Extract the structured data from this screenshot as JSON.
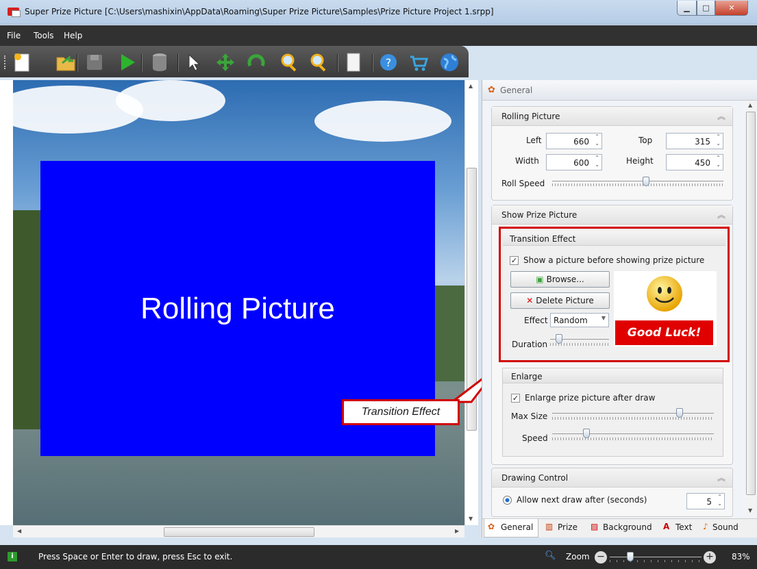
{
  "window": {
    "title": "Super Prize Picture [C:\\Users\\mashixin\\AppData\\Roaming\\Super Prize Picture\\Samples\\Prize Picture Project 1.srpp]",
    "min": "▁",
    "max": "□",
    "close": "✕"
  },
  "menu": [
    "File",
    "Tools",
    "Help"
  ],
  "toolbar": [
    {
      "icon": "new-document-icon"
    },
    {
      "icon": "open-folder-icon"
    },
    {
      "icon": "save-icon"
    },
    {
      "icon": "play-icon"
    },
    {
      "icon": "database-icon"
    },
    {
      "icon": "pointer-icon"
    },
    {
      "icon": "move-icon"
    },
    {
      "icon": "rotate-icon"
    },
    {
      "icon": "zoom-in-icon"
    },
    {
      "icon": "zoom-out-icon"
    },
    {
      "icon": "page-icon"
    },
    {
      "icon": "help-icon"
    },
    {
      "icon": "cart-icon"
    },
    {
      "icon": "globe-icon"
    }
  ],
  "canvas": {
    "rolling_text": "Rolling Picture",
    "callout": "Transition Effect"
  },
  "panel": {
    "header": "General",
    "rolling": {
      "title": "Rolling Picture",
      "left_label": "Left",
      "left": "660",
      "top_label": "Top",
      "top": "315",
      "width_label": "Width",
      "width": "600",
      "height_label": "Height",
      "height": "450",
      "speed_label": "Roll Speed",
      "speed_level": 0.55
    },
    "show_prize": {
      "title": "Show Prize Picture"
    },
    "transition": {
      "title": "Transition Effect",
      "checkbox_label": "Show a picture before showing prize picture",
      "checked": true,
      "browse": "Browse...",
      "delete": "Delete Picture",
      "effect_label": "Effect",
      "effect_value": "Random",
      "duration_label": "Duration",
      "duration_level": 0.1,
      "good_luck": "Good Luck!"
    },
    "enlarge": {
      "title": "Enlarge",
      "checkbox_label": "Enlarge prize picture after draw",
      "checked": true,
      "max_label": "Max Size",
      "max_level": 0.8,
      "speed_label": "Speed",
      "speed_level": 0.2
    },
    "drawing": {
      "title": "Drawing Control",
      "radio_label": "Allow next draw after (seconds)",
      "seconds": "5"
    },
    "tabs": [
      "General",
      "Prize",
      "Background",
      "Text",
      "Sound"
    ]
  },
  "status": {
    "message": "Press Space or Enter to draw, press Esc to exit.",
    "zoom_label": "Zoom",
    "zoom_value": "83%",
    "zoom_level": 0.2
  },
  "colors": {
    "red_border": "#d10000",
    "rolling_bg": "#0000ff",
    "good_luck_bg": "#e00000"
  }
}
